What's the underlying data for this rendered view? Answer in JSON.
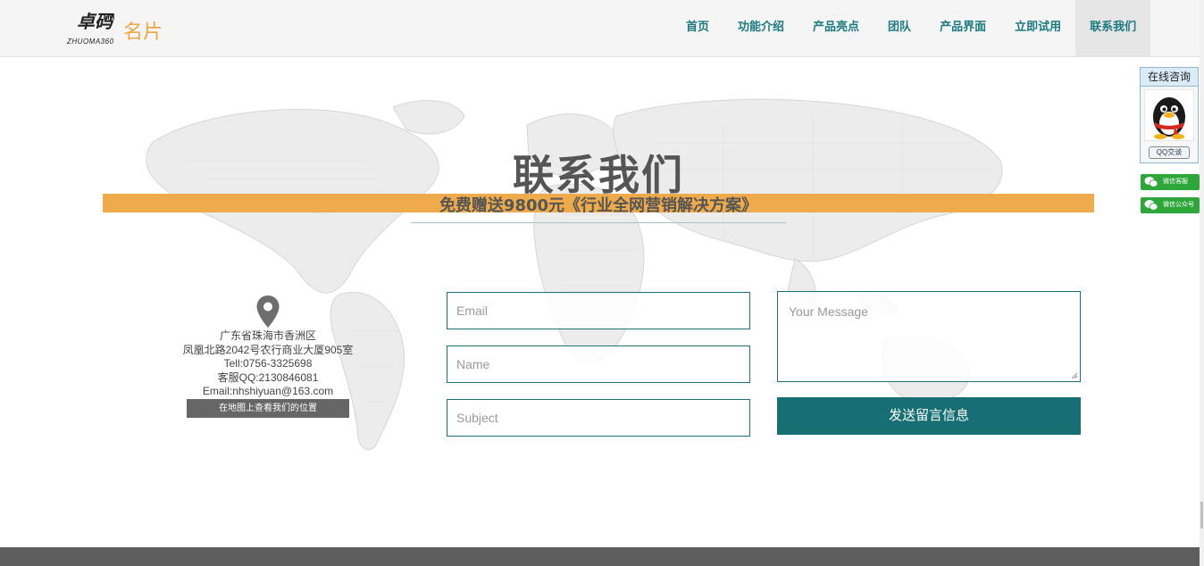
{
  "header": {
    "logo_cn": "卓码",
    "logo_tm": "TM",
    "logo_en": "ZHUOMA360",
    "site_title": "名片"
  },
  "nav": {
    "items": [
      {
        "label": "首页"
      },
      {
        "label": "功能介绍"
      },
      {
        "label": "产品亮点"
      },
      {
        "label": "团队"
      },
      {
        "label": "产品界面"
      },
      {
        "label": "立即试用"
      },
      {
        "label": "联系我们"
      }
    ],
    "active_index": 6
  },
  "section": {
    "title": "联系我们",
    "subtitle": "免费赠送9800元《行业全网营销解决方案》"
  },
  "address": {
    "line1": "广东省珠海市香洲区",
    "line2": "凤凰北路2042号农行商业大厦905室",
    "tel": "Tell:0756-3325698",
    "qq": "客服QQ:2130846081",
    "email": "Email:nhshiyuan@163.com",
    "map_button": "在地图上查看我们的位置"
  },
  "form": {
    "email_placeholder": "Email",
    "name_placeholder": "Name",
    "subject_placeholder": "Subject",
    "message_placeholder": "Your Message",
    "submit_label": "发送留言信息"
  },
  "float": {
    "consult_title": "在线咨询",
    "qq_button": "QQ交谈",
    "wechat_service": "微信客服",
    "wechat_public": "微信公众号"
  },
  "colors": {
    "accent_teal": "#176f73",
    "nav_text": "#1b7a80",
    "banner_orange": "#efab4b",
    "logo_orange": "#f0a445",
    "wechat_green": "#2fa63a"
  },
  "icons": [
    "map-pin-icon",
    "qq-penguin-icon",
    "wechat-icon"
  ]
}
